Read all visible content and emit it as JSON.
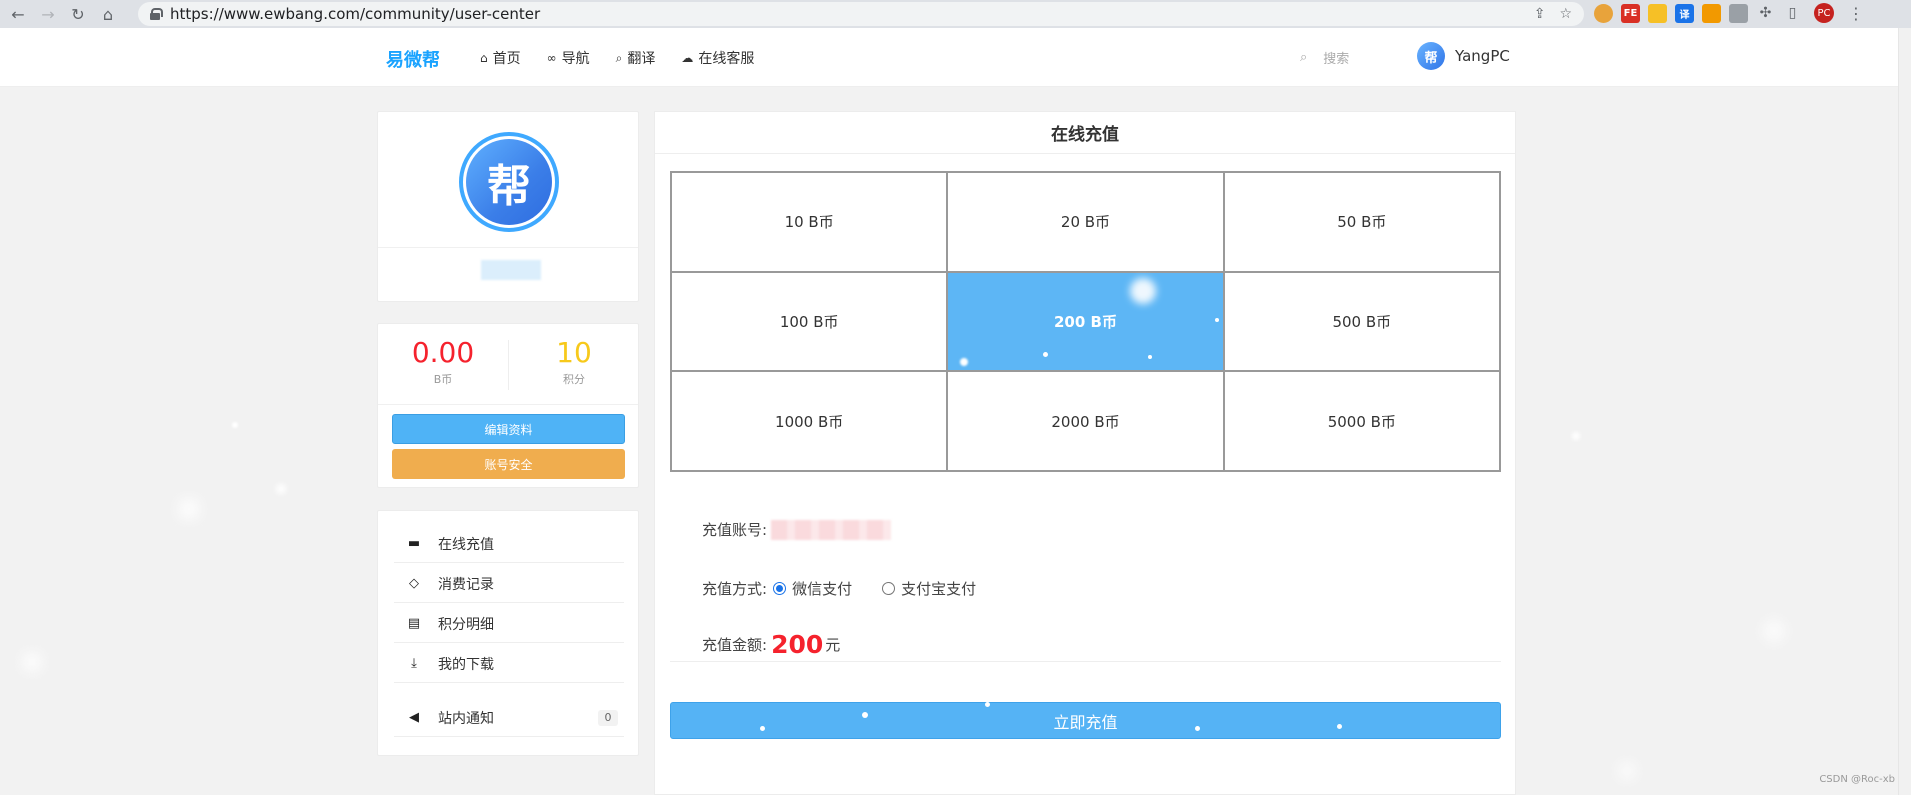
{
  "browser": {
    "url": "https://www.ewbang.com/community/user-center",
    "profile_initials": "PC"
  },
  "header": {
    "logo": "易微帮",
    "nav": [
      {
        "label": "首页",
        "icon": "home-icon",
        "glyph": "⌂"
      },
      {
        "label": "导航",
        "icon": "link-icon",
        "glyph": "∞"
      },
      {
        "label": "翻译",
        "icon": "search-icon",
        "glyph": "⌕"
      },
      {
        "label": "在线客服",
        "icon": "chat-icon",
        "glyph": "☁"
      }
    ],
    "search_placeholder": "搜索",
    "username": "YangPC",
    "avatar_char": "帮"
  },
  "profile": {
    "avatar_char": "帮"
  },
  "stats": {
    "bcoin_value": "0.00",
    "bcoin_label": "B币",
    "points_value": "10",
    "points_label": "积分",
    "edit_button": "编辑资料",
    "security_button": "账号安全"
  },
  "menu": [
    {
      "label": "在线充值",
      "icon": "card-icon",
      "glyph": "▬"
    },
    {
      "label": "消费记录",
      "icon": "diamond-icon",
      "glyph": "◇"
    },
    {
      "label": "积分明细",
      "icon": "file-icon",
      "glyph": "▤"
    },
    {
      "label": "我的下载",
      "icon": "download-icon",
      "glyph": "⤓"
    },
    {
      "label": "站内通知",
      "icon": "bullhorn-icon",
      "glyph": "◀",
      "badge": "0"
    }
  ],
  "recharge": {
    "title": "在线充值",
    "options": [
      "10 B币",
      "20 B币",
      "50 B币",
      "100 B币",
      "200 B币",
      "500 B币",
      "1000 B币",
      "2000 B币",
      "5000 B币"
    ],
    "selected_index": 4,
    "account_label": "充值账号:",
    "method_label": "充值方式:",
    "methods": [
      "微信支付",
      "支付宝支付"
    ],
    "selected_method": "微信支付",
    "amount_label": "充值金额:",
    "amount_value": "200",
    "amount_unit": "元",
    "submit_label": "立即充值"
  },
  "watermark": "CSDN @Roc-xb"
}
